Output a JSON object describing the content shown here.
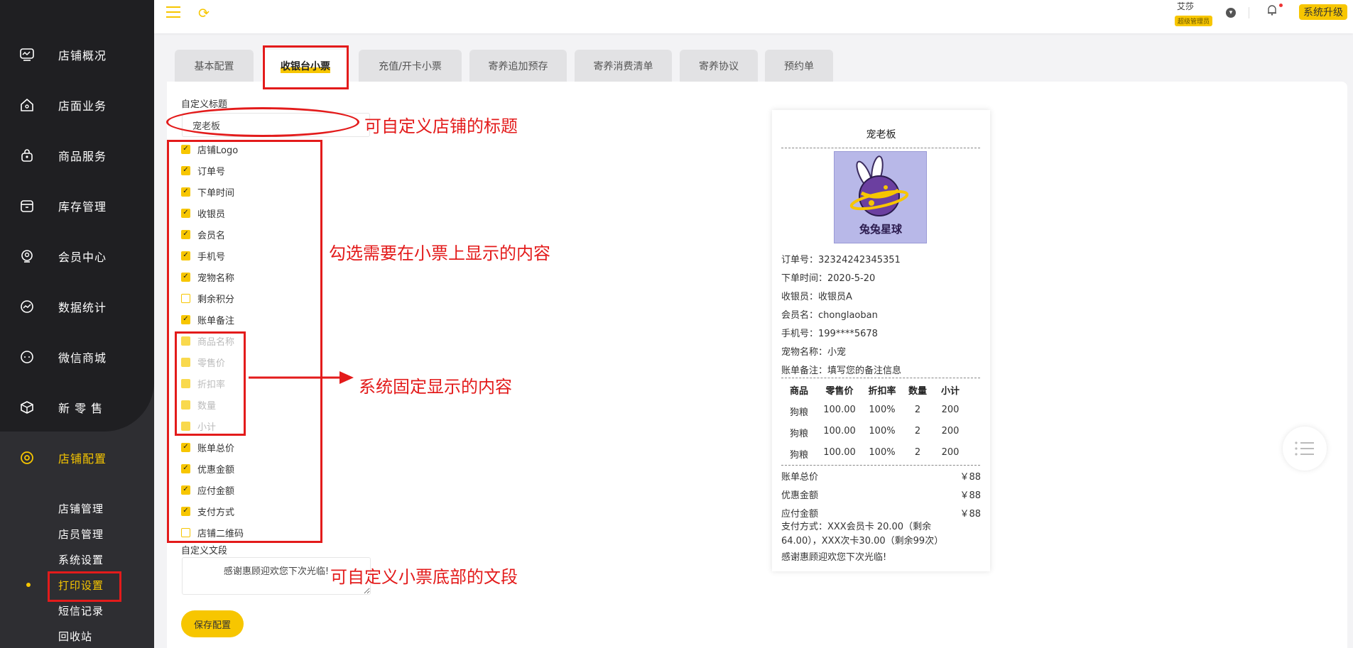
{
  "sidebar": {
    "items": [
      {
        "label": "店铺概况",
        "icon": "monitor-icon"
      },
      {
        "label": "店面业务",
        "icon": "home-icon"
      },
      {
        "label": "商品服务",
        "icon": "bag-icon"
      },
      {
        "label": "库存管理",
        "icon": "box-icon"
      },
      {
        "label": "会员中心",
        "icon": "member-icon"
      },
      {
        "label": "数据统计",
        "icon": "chart-icon"
      },
      {
        "label": "微信商城",
        "icon": "chat-icon"
      },
      {
        "label": "新 零 售",
        "icon": "cube-icon"
      },
      {
        "label": "店铺配置",
        "icon": "settings-icon"
      }
    ],
    "sub_items": [
      "店铺管理",
      "店员管理",
      "系统设置",
      "打印设置",
      "短信记录",
      "回收站"
    ]
  },
  "header": {
    "user_name": "艾莎",
    "user_role": "超级管理员",
    "upgrade_label": "系统升级"
  },
  "tabs": [
    "基本配置",
    "收银台小票",
    "充值/开卡小票",
    "寄养追加预存",
    "寄养消费清单",
    "寄养协议",
    "预约单"
  ],
  "form": {
    "title_label": "自定义标题",
    "title_value": "宠老板",
    "checkboxes": [
      {
        "label": "店铺Logo",
        "state": "checked"
      },
      {
        "label": "订单号",
        "state": "checked"
      },
      {
        "label": "下单时间",
        "state": "checked"
      },
      {
        "label": "收银员",
        "state": "checked"
      },
      {
        "label": "会员名",
        "state": "checked"
      },
      {
        "label": "手机号",
        "state": "checked"
      },
      {
        "label": "宠物名称",
        "state": "checked"
      },
      {
        "label": "剩余积分",
        "state": "unchecked"
      },
      {
        "label": "账单备注",
        "state": "checked"
      },
      {
        "label": "商品名称",
        "state": "fixed"
      },
      {
        "label": "零售价",
        "state": "fixed"
      },
      {
        "label": "折扣率",
        "state": "fixed"
      },
      {
        "label": "数量",
        "state": "fixed"
      },
      {
        "label": "小计",
        "state": "fixed"
      },
      {
        "label": "账单总价",
        "state": "checked"
      },
      {
        "label": "优惠金额",
        "state": "checked"
      },
      {
        "label": "应付金额",
        "state": "checked"
      },
      {
        "label": "支付方式",
        "state": "checked"
      },
      {
        "label": "店铺二维码",
        "state": "unchecked"
      }
    ],
    "footer_label": "自定义文段",
    "footer_value": "感谢惠顾迎欢您下次光临!",
    "save_label": "保存配置"
  },
  "annotations": {
    "title": "可自定义店铺的标题",
    "select": "勾选需要在小票上显示的内容",
    "fixed": "系统固定显示的内容",
    "footer": "可自定义小票底部的文段"
  },
  "receipt": {
    "title": "宠老板",
    "logo_text": "兔兔星球",
    "info": [
      "订单号：32324242345351",
      "下单时间：2020-5-20",
      "收银员：收银员A",
      "会员名：chonglaoban",
      "手机号：199****5678",
      "宠物名称：小宠",
      "账单备注：填写您的备注信息"
    ],
    "table_headers": [
      "商品",
      "零售价",
      "折扣率",
      "数量",
      "小计"
    ],
    "table_rows": [
      [
        "狗粮",
        "100.00",
        "100%",
        "2",
        "200"
      ],
      [
        "狗粮",
        "100.00",
        "100%",
        "2",
        "200"
      ],
      [
        "狗粮",
        "100.00",
        "100%",
        "2",
        "200"
      ]
    ],
    "totals": [
      {
        "label": "账单总价",
        "value": "￥88"
      },
      {
        "label": "优惠金额",
        "value": "￥88"
      },
      {
        "label": "应付金额",
        "value": "￥88"
      }
    ],
    "payment": "支付方式：XXX会员卡 20.00（剩余64.00），XXX次卡30.00（剩余99次）",
    "footer": "感谢惠顾迎欢您下次光临!"
  },
  "colors": {
    "accent": "#f7c600",
    "sidebar": "#2e2e32",
    "annotation": "#e31b1b"
  }
}
